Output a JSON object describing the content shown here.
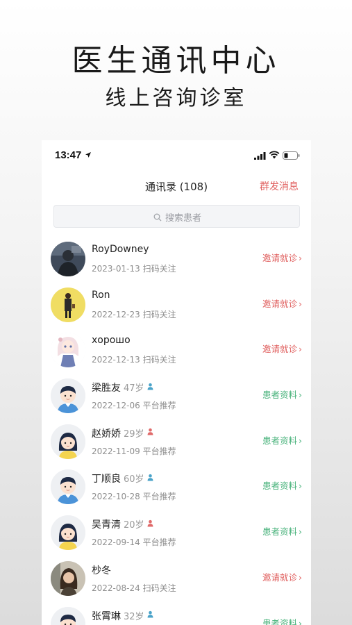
{
  "hero": {
    "title": "医生通讯中心",
    "subtitle": "线上咨询诊室"
  },
  "status_bar": {
    "time": "13:47"
  },
  "nav": {
    "title": "通讯录 (108)",
    "action": "群发消息"
  },
  "search": {
    "placeholder": "搜索患者"
  },
  "colors": {
    "action_red": "#e0605f",
    "action_green": "#47b27a",
    "male_icon": "#4aa3c9",
    "female_icon": "#e06a6a"
  },
  "contacts": [
    {
      "name": "RoyDowney",
      "age": "",
      "sex": "",
      "date": "2023-01-13",
      "source": "扫码关注",
      "action": "邀请就诊",
      "action_color": "red",
      "avatar": "photo-dark"
    },
    {
      "name": "Ron",
      "age": "",
      "sex": "",
      "date": "2022-12-23",
      "source": "扫码关注",
      "action": "邀请就诊",
      "action_color": "red",
      "avatar": "photo-yellow"
    },
    {
      "name": "хорошо",
      "age": "",
      "sex": "",
      "date": "2022-12-13",
      "source": "扫码关注",
      "action": "邀请就诊",
      "action_color": "red",
      "avatar": "anime-girl"
    },
    {
      "name": "梁胜友",
      "age": "47岁",
      "sex": "male",
      "date": "2022-12-06",
      "source": "平台推荐",
      "action": "患者资料",
      "action_color": "green",
      "avatar": "cartoon-male"
    },
    {
      "name": "赵娇娇",
      "age": "29岁",
      "sex": "female",
      "date": "2022-11-09",
      "source": "平台推荐",
      "action": "患者资料",
      "action_color": "green",
      "avatar": "cartoon-female"
    },
    {
      "name": "丁顺良",
      "age": "60岁",
      "sex": "male",
      "date": "2022-10-28",
      "source": "平台推荐",
      "action": "患者资料",
      "action_color": "green",
      "avatar": "cartoon-male"
    },
    {
      "name": "吴青清",
      "age": "20岁",
      "sex": "female",
      "date": "2022-09-14",
      "source": "平台推荐",
      "action": "患者资料",
      "action_color": "green",
      "avatar": "cartoon-female"
    },
    {
      "name": "杪冬",
      "age": "",
      "sex": "",
      "date": "2022-08-24",
      "source": "扫码关注",
      "action": "邀请就诊",
      "action_color": "red",
      "avatar": "photo-woman"
    },
    {
      "name": "张霄琳",
      "age": "32岁",
      "sex": "male",
      "date": "",
      "source": "",
      "action": "患者资料",
      "action_color": "green",
      "avatar": "cartoon-male"
    }
  ]
}
